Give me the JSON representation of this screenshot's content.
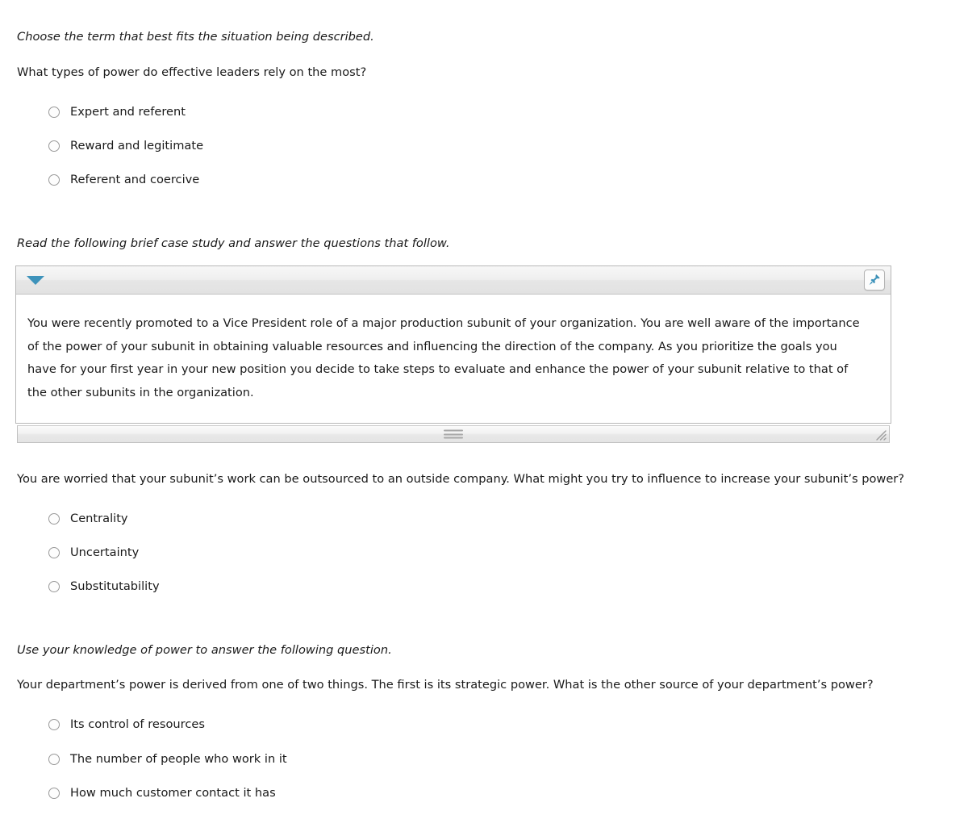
{
  "sections": [
    {
      "directive": "Choose the term that best fits the situation being described.",
      "question": "What types of power do effective leaders rely on the most?",
      "options": [
        "Expert and referent",
        "Reward and legitimate",
        "Referent and coercive"
      ]
    },
    {
      "directive": "Read the following brief case study and answer the questions that follow.",
      "question": "You are worried that your subunit’s work can be outsourced to an outside company. What might you try to influence to increase your subunit’s power?",
      "options": [
        "Centrality",
        "Uncertainty",
        "Substitutability"
      ]
    },
    {
      "directive": "Use your knowledge of power to answer the following question.",
      "question": "Your department’s power is derived from one of two things. The first is its strategic power. What is the other source of your department’s power?",
      "options": [
        "Its control of resources",
        "The number of people who work in it",
        "How much customer contact it has"
      ]
    }
  ],
  "case_study": {
    "collapse_icon": "triangle-down-icon",
    "pin_icon": "pushpin-icon",
    "drag_handle_icon": "drag-handle-icon",
    "resize_icon": "resize-grip-icon",
    "body": "You were recently promoted to a Vice President role of a major production subunit of your organization. You are well aware of the importance of the power of your subunit in obtaining valuable resources and influencing the direction of the company. As you prioritize the goals you have for your first year in your new position you decide to take steps to evaluate and enhance the power of your subunit relative to that of the other subunits in the organization."
  },
  "colors": {
    "accent": "#3e93bb",
    "text": "#1a1a1a",
    "panel_border": "#b8b8b8"
  }
}
